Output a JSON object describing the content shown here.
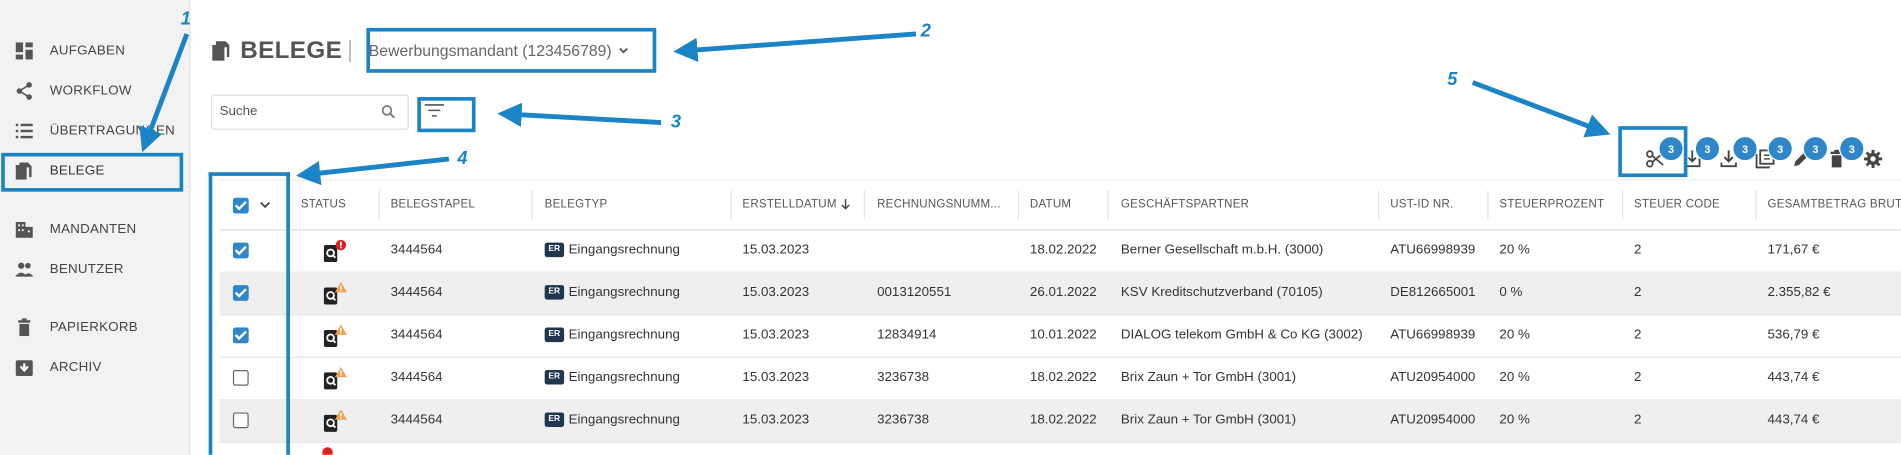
{
  "sidebar": {
    "items": [
      {
        "label": "AUFGABEN",
        "icon": "dashboard-icon"
      },
      {
        "label": "WORKFLOW",
        "icon": "share-icon"
      },
      {
        "label": "ÜBERTRAGUNGEN",
        "icon": "list-icon"
      },
      {
        "label": "BELEGE",
        "icon": "documents-icon"
      },
      {
        "label": "MANDANTEN",
        "icon": "building-icon"
      },
      {
        "label": "BENUTZER",
        "icon": "users-icon"
      },
      {
        "label": "PAPIERKORB",
        "icon": "trash-icon"
      },
      {
        "label": "ARCHIV",
        "icon": "archive-icon"
      }
    ],
    "active_item": "BELEGE"
  },
  "header": {
    "title": "BELEGE",
    "tenant": "Bewerbungsmandant (123456789)"
  },
  "search": {
    "placeholder": "Suche",
    "value": ""
  },
  "toolbar": {
    "badge_count": "3",
    "tools": [
      "scissors-icon",
      "import-icon",
      "download-icon",
      "copy-icon",
      "edit-icon",
      "delete-icon",
      "settings-icon"
    ]
  },
  "table": {
    "columns": [
      "STATUS",
      "BELEGSTAPEL",
      "BELEGTYP",
      "ERSTELLDATUM",
      "RECHNUNGSNUMM...",
      "DATUM",
      "GESCHÄFTSPARTNER",
      "UST-ID NR.",
      "STEUERPROZENT",
      "STEUER CODE",
      "GESAMTBETRAG BRUT"
    ],
    "sort_column": "ERSTELLDATUM",
    "sort_direction": "descending",
    "rows": [
      {
        "checked": true,
        "status": "error",
        "belegstapel": "3444564",
        "tag": "ER",
        "belegtyp": "Eingangsrechnung",
        "erstelldatum": "15.03.2023",
        "rechnungsnummer": "",
        "datum": "18.02.2022",
        "partner": "Berner Gesellschaft m.b.H. (3000)",
        "ustid": "ATU66998939",
        "steuerprozent": "20 %",
        "steuercode": "2",
        "gesamtbetrag": "171,67 €"
      },
      {
        "checked": true,
        "status": "warning",
        "belegstapel": "3444564",
        "tag": "ER",
        "belegtyp": "Eingangsrechnung",
        "erstelldatum": "15.03.2023",
        "rechnungsnummer": "0013120551",
        "datum": "26.01.2022",
        "partner": "KSV Kreditschutzverband (70105)",
        "ustid": "DE812665001",
        "steuerprozent": "0 %",
        "steuercode": "2",
        "gesamtbetrag": "2.355,82 €"
      },
      {
        "checked": true,
        "status": "warning",
        "belegstapel": "3444564",
        "tag": "ER",
        "belegtyp": "Eingangsrechnung",
        "erstelldatum": "15.03.2023",
        "rechnungsnummer": "12834914",
        "datum": "10.01.2022",
        "partner": "DIALOG telekom GmbH & Co KG (3002)",
        "ustid": "ATU66998939",
        "steuerprozent": "20 %",
        "steuercode": "2",
        "gesamtbetrag": "536,79 €"
      },
      {
        "checked": false,
        "status": "warning",
        "belegstapel": "3444564",
        "tag": "ER",
        "belegtyp": "Eingangsrechnung",
        "erstelldatum": "15.03.2023",
        "rechnungsnummer": "3236738",
        "datum": "18.02.2022",
        "partner": "Brix Zaun + Tor GmbH (3001)",
        "ustid": "ATU20954000",
        "steuerprozent": "20 %",
        "steuercode": "2",
        "gesamtbetrag": "443,74 €"
      },
      {
        "checked": false,
        "status": "warning",
        "belegstapel": "3444564",
        "tag": "ER",
        "belegtyp": "Eingangsrechnung",
        "erstelldatum": "15.03.2023",
        "rechnungsnummer": "3236738",
        "datum": "18.02.2022",
        "partner": "Brix Zaun + Tor GmbH (3001)",
        "ustid": "ATU20954000",
        "steuerprozent": "20 %",
        "steuercode": "2",
        "gesamtbetrag": "443,74 €"
      }
    ]
  },
  "annotations": [
    "1",
    "2",
    "3",
    "4",
    "5"
  ],
  "colors": {
    "accent": "#2f86c9",
    "annotation": "#1b84c6",
    "warning": "#f0a050",
    "error": "#e02020",
    "tag_bg": "#1f3550"
  }
}
